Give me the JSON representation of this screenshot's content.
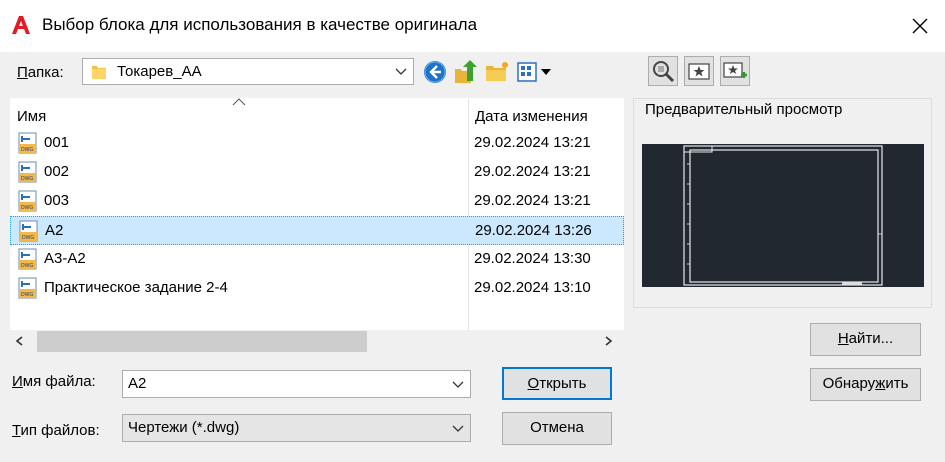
{
  "window": {
    "title": "Выбор блока для использования в качестве оригинала",
    "app_icon": "autocad-logo",
    "close_icon": "close-icon"
  },
  "folder": {
    "label_prefix": "П",
    "label_rest": "апка:",
    "value": "Токарев_АА"
  },
  "toolbar": {
    "back_icon": "back-icon",
    "up_icon": "up-folder-icon",
    "new_folder_icon": "new-folder-icon",
    "views_icon": "views-icon",
    "tree_view_icon": "tree-view-icon",
    "favorites_icon": "favorites-icon",
    "add_favorite_icon": "add-favorite-icon"
  },
  "file_list": {
    "columns": [
      "Имя",
      "Дата изменения"
    ],
    "rows": [
      {
        "name": "001",
        "date": "29.02.2024 13:21",
        "selected": false
      },
      {
        "name": "002",
        "date": "29.02.2024 13:21",
        "selected": false
      },
      {
        "name": "003",
        "date": "29.02.2024 13:21",
        "selected": false
      },
      {
        "name": "A2",
        "date": "29.02.2024 13:26",
        "selected": true
      },
      {
        "name": "A3-A2",
        "date": "29.02.2024 13:30",
        "selected": false
      },
      {
        "name": "Практическое задание 2-4",
        "date": "29.02.2024 13:10",
        "selected": false
      }
    ]
  },
  "preview": {
    "label": "Предварительный просмотр"
  },
  "filename": {
    "label_prefix": "И",
    "label_rest": "мя файла:",
    "value": "A2"
  },
  "filetype": {
    "label_prefix": "Т",
    "label_rest": "ип файлов:",
    "value": "Чертежи (*.dwg)"
  },
  "buttons": {
    "open_prefix": "О",
    "open_rest": "ткрыть",
    "cancel": "Отмена",
    "find_prefix": "Н",
    "find_rest": "айти...",
    "locate_pre": "Обнару",
    "locate_u": "ж",
    "locate_post": "ить"
  },
  "colors": {
    "accent": "#0078d7",
    "selection": "#cce8ff",
    "preview_bg": "#212830"
  }
}
